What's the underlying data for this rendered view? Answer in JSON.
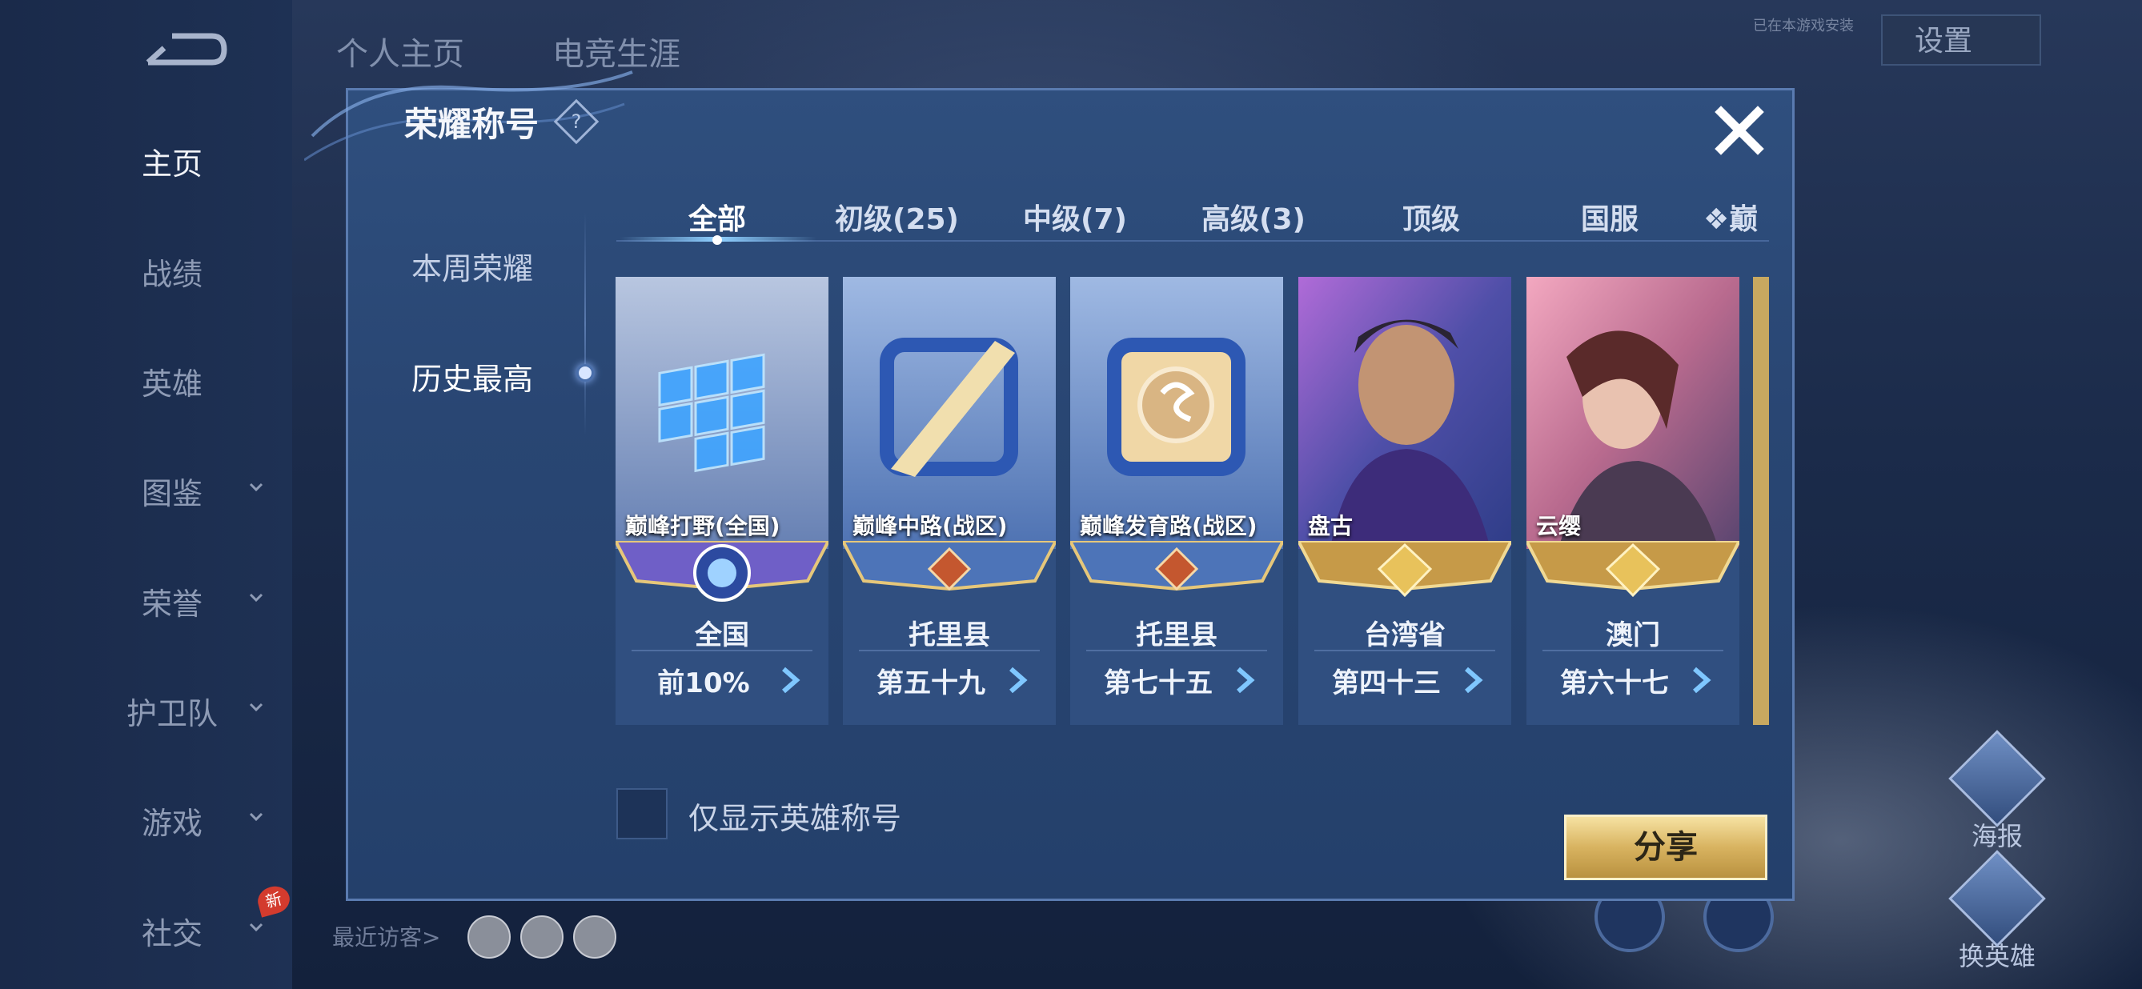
{
  "nav": {
    "items": [
      {
        "label": "主页",
        "active": true,
        "chevron": false
      },
      {
        "label": "战绩",
        "active": false,
        "chevron": false
      },
      {
        "label": "英雄",
        "active": false,
        "chevron": false
      },
      {
        "label": "图鉴",
        "active": false,
        "chevron": true
      },
      {
        "label": "荣誉",
        "active": false,
        "chevron": true
      },
      {
        "label": "护卫队",
        "active": false,
        "chevron": true
      },
      {
        "label": "游戏",
        "active": false,
        "chevron": true
      },
      {
        "label": "社交",
        "active": false,
        "chevron": true
      }
    ],
    "new_badge": "新"
  },
  "background": {
    "tabs": [
      "个人主页",
      "电竞生涯"
    ],
    "settings_label": "设置",
    "small_hint": "已在本游戏安装",
    "visitors_label": "最近访客>",
    "right_buttons": [
      "海报",
      "换英雄"
    ]
  },
  "modal": {
    "title": "荣耀称号",
    "help_symbol": "?",
    "side_tabs": [
      "本周荣耀",
      "历史最高"
    ],
    "active_side_tab": 1,
    "tabs": [
      "全部",
      "初级(25)",
      "中级(7)",
      "高级(3)",
      "顶级",
      "国服",
      "❖巅"
    ],
    "active_tab": 0,
    "cards": [
      {
        "title": "巅峰打野(全国)",
        "region": "全国",
        "rank": "前10%",
        "style": "purple"
      },
      {
        "title": "巅峰中路(战区)",
        "region": "托里县",
        "rank": "第五十九",
        "style": "blue"
      },
      {
        "title": "巅峰发育路(战区)",
        "region": "托里县",
        "rank": "第七十五",
        "style": "blue"
      },
      {
        "title": "盘古",
        "region": "台湾省",
        "rank": "第四十三",
        "style": "gold"
      },
      {
        "title": "云缨",
        "region": "澳门",
        "rank": "第六十七",
        "style": "gold"
      }
    ],
    "checkbox_label": "仅显示英雄称号",
    "share_label": "分享"
  },
  "colors": {
    "accent": "#f6e2a2",
    "modal_bg": "#2b4a78",
    "text_active": "#ffffff"
  }
}
